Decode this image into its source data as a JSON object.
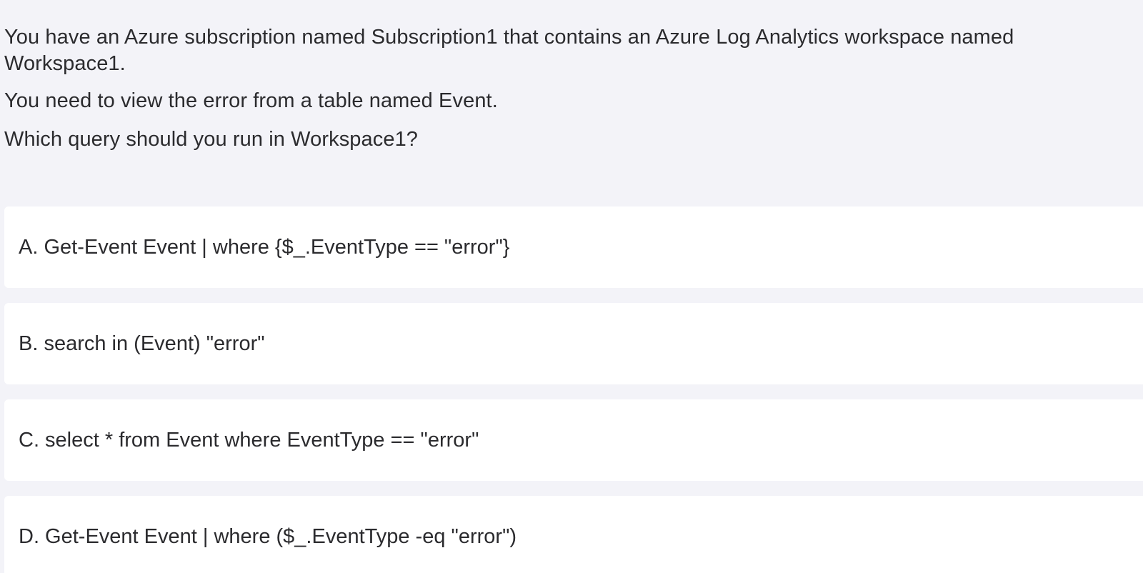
{
  "question": {
    "line1": "You have an Azure subscription named Subscription1 that contains an Azure Log Analytics workspace named",
    "line2": "Workspace1.",
    "line3": "You need to view the error from a table named Event.",
    "line4": "Which query should you run in Workspace1?"
  },
  "options": [
    {
      "text": "A. Get-Event Event | where {$_.EventType == \"error\"}"
    },
    {
      "text": "B. search in (Event) \"error\""
    },
    {
      "text": "C. select * from Event where EventType == \"error\""
    },
    {
      "text": "D. Get-Event Event | where ($_.EventType -eq \"error\")"
    }
  ]
}
